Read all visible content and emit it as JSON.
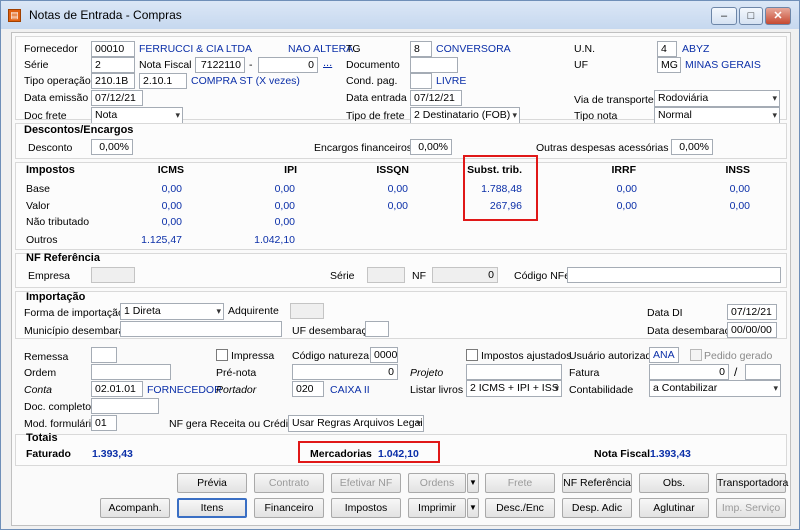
{
  "window": {
    "title": "Notas de Entrada - Compras",
    "app_icon": "document-icon",
    "controls": [
      "–",
      "□",
      "✕"
    ]
  },
  "header": {
    "fornecedor_label": "Fornecedor",
    "fornecedor_code": "00010",
    "fornecedor_name": "FERRUCCI & CIA LTDA",
    "nao_altera": "NAO ALTERA",
    "tg_label": "TG",
    "tg_code": "8",
    "tg_name": "CONVERSORA",
    "un_label": "U.N.",
    "un_code": "4",
    "un_name": "ABYZ",
    "serie_label": "Série",
    "serie_value": "2",
    "nota_fiscal_label": "Nota Fiscal",
    "nota_fiscal_value": "7122110",
    "nota_dash": "-",
    "nota_suffix": "0",
    "nota_ellipsis": "...",
    "documento_label": "Documento",
    "documento_value": "",
    "uf_label": "UF",
    "uf_code": "MG",
    "uf_name": "MINAS GERAIS",
    "tipo_operacao_label": "Tipo operação",
    "tipo_operacao_1": "210.1B",
    "tipo_operacao_2": "2.10.1",
    "tipo_operacao_desc": "COMPRA ST (X vezes)",
    "cond_pag_label": "Cond. pag.",
    "cond_pag_value": "",
    "cond_pag_desc": "LIVRE",
    "data_emissao_label": "Data emissão",
    "data_emissao_value": "07/12/21",
    "data_entrada_label": "Data entrada",
    "data_entrada_value": "07/12/21",
    "via_transporte_label": "Via de transporte",
    "via_transporte_value": "Rodoviária",
    "doc_frete_label": "Doc frete",
    "doc_frete_value": "Nota",
    "tipo_frete_label": "Tipo de frete",
    "tipo_frete_value": "2 Destinatario (FOB)",
    "tipo_nota_label": "Tipo nota",
    "tipo_nota_value": "Normal"
  },
  "descontos": {
    "title": "Descontos/Encargos",
    "desconto_label": "Desconto",
    "desconto_value": "0,00%",
    "encargos_label": "Encargos financeiros",
    "encargos_value": "0,00%",
    "outras_label": "Outras despesas acessórias",
    "outras_value": "0,00%"
  },
  "impostos": {
    "title": "Impostos",
    "columns": [
      "ICMS",
      "IPI",
      "ISSQN",
      "Subst. trib.",
      "IRRF",
      "INSS"
    ],
    "rows": [
      {
        "label": "Base",
        "values": [
          "0,00",
          "0,00",
          "0,00",
          "1.788,48",
          "0,00",
          "0,00"
        ]
      },
      {
        "label": "Valor",
        "values": [
          "0,00",
          "0,00",
          "0,00",
          "267,96",
          "0,00",
          "0,00"
        ]
      },
      {
        "label": "Não tributado",
        "values": [
          "0,00",
          "0,00",
          "",
          "",
          "",
          ""
        ]
      },
      {
        "label": "Outros",
        "values": [
          "1.125,47",
          "1.042,10",
          "",
          "",
          "",
          ""
        ]
      }
    ]
  },
  "nf_referencia": {
    "title": "NF Referência",
    "empresa_label": "Empresa",
    "empresa_value": "",
    "serie_label": "Série",
    "serie_value": "",
    "nf_label": "NF",
    "nf_value": "0",
    "codigo_nfe_label": "Código NFe",
    "codigo_nfe_value": ""
  },
  "importacao": {
    "title": "Importação",
    "forma_label": "Forma de importação",
    "forma_value": "1 Direta",
    "adquirente_label": "Adquirente",
    "adquirente_value": "",
    "data_di_label": "Data DI",
    "data_di_value": "07/12/21",
    "municipio_label": "Município desembaraço",
    "municipio_value": "",
    "uf_label": "UF desembaraço",
    "uf_value": "",
    "data_desembaraco_label": "Data desembaraço",
    "data_desembaraco_value": "00/00/00"
  },
  "misc": {
    "remessa_label": "Remessa",
    "remessa_value": "",
    "impressa_label": "Impressa",
    "codigo_natureza_label": "Código natureza",
    "codigo_natureza_value": "0000",
    "impostos_ajustados_label": "Impostos ajustados",
    "usuario_label": "Usuário autorizado",
    "usuario_value": "ANA",
    "pedido_gerado_label": "Pedido gerado",
    "ordem_label": "Ordem",
    "ordem_value": "",
    "pre_nota_label": "Pré-nota",
    "pre_nota_value": "0",
    "projeto_label": "Projeto",
    "projeto_value": "",
    "fatura_label": "Fatura",
    "fatura_value": "0",
    "fatura_sep": "/",
    "fatura_value2": "",
    "conta_label": "Conta",
    "conta_value": "02.01.01",
    "conta_desc": "FORNECEDOR",
    "portador_label": "Portador",
    "portador_value": "020",
    "portador_desc": "CAIXA II",
    "listar_livros_label": "Listar livros",
    "listar_livros_value": "2 ICMS + IPI + ISS",
    "contabilidade_label": "Contabilidade",
    "contabilidade_value": "a Contabilizar",
    "doc_completo_label": "Doc. completo",
    "doc_completo_value": "",
    "mod_formulario_label": "Mod. formulário",
    "mod_formulario_value": "01",
    "nf_gera_label": "NF gera Receita ou Crédito",
    "nf_gera_value": "Usar Regras Arquivos Legais"
  },
  "totais": {
    "title": "Totais",
    "faturado_label": "Faturado",
    "faturado_value": "1.393,43",
    "mercadorias_label": "Mercadorias",
    "mercadorias_value": "1.042,10",
    "nota_fiscal_label": "Nota Fiscal",
    "nota_fiscal_value": "1.393,43"
  },
  "buttons": {
    "row1": [
      "Prévia",
      "Contrato",
      "Efetivar NF",
      "Ordens",
      "Frete",
      "NF Referência",
      "Obs.",
      "Transportadora"
    ],
    "row2": [
      "Acompanh.",
      "Itens",
      "Financeiro",
      "Impostos",
      "Imprimir",
      "Desc./Enc",
      "Desp. Adic",
      "Aglutinar",
      "Imp. Serviço"
    ],
    "dropdown_arrow": "▼"
  },
  "colors": {
    "highlight": "#e01818",
    "value_blue": "#0b2fa8",
    "window_frame": "#6f8fb8"
  }
}
